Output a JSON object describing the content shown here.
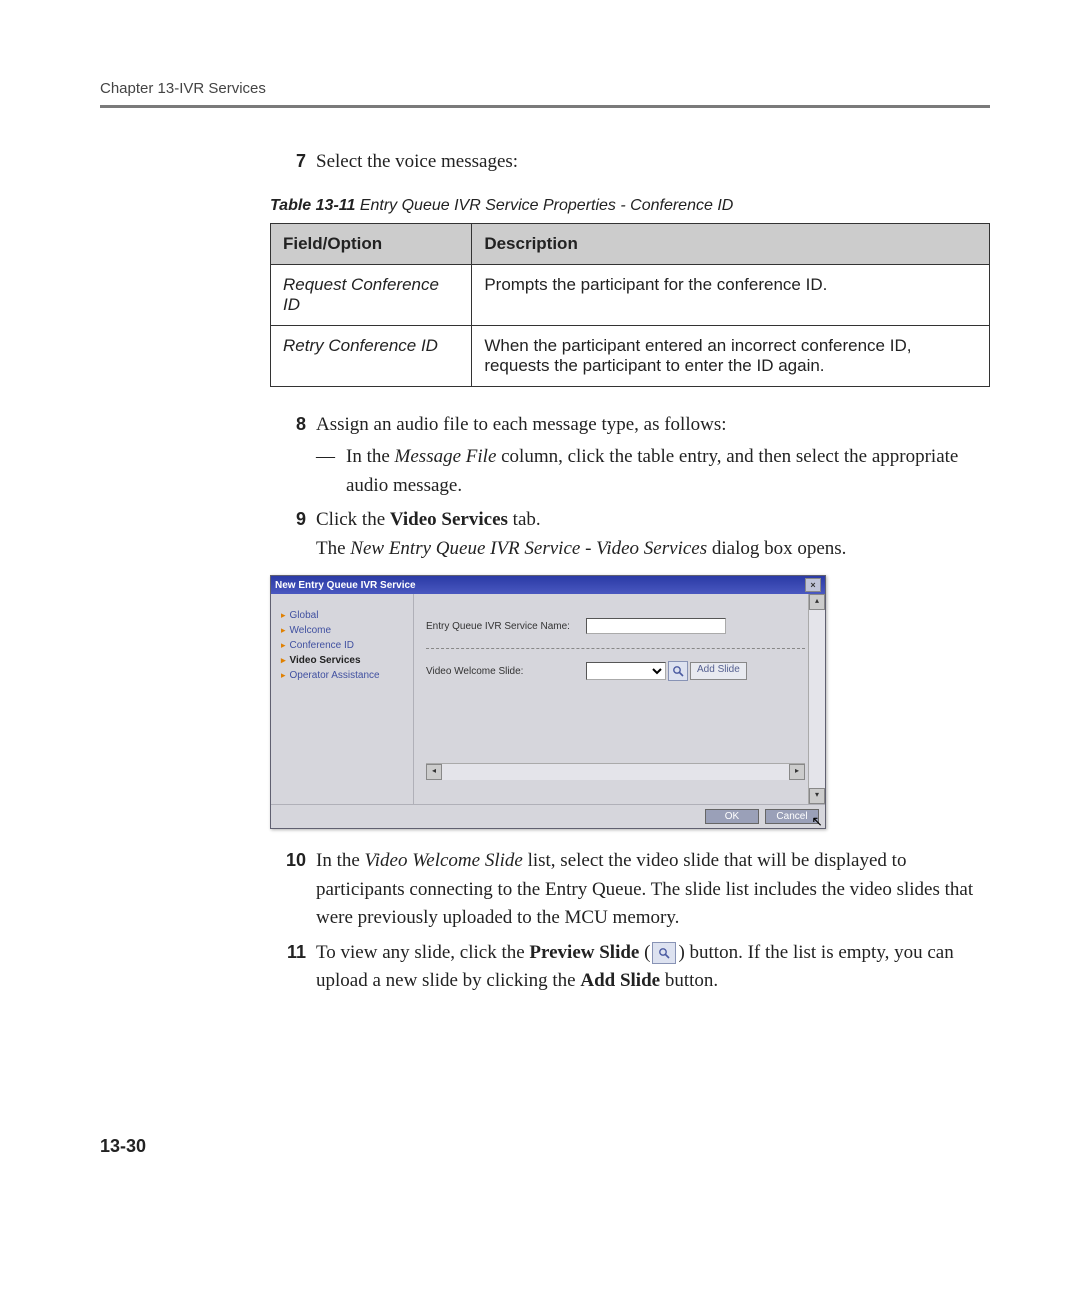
{
  "header": {
    "running": "Chapter 13-IVR Services"
  },
  "steps": {
    "s7": {
      "num": "7",
      "text": "Select the voice messages:"
    },
    "s8": {
      "num": "8",
      "text": "Assign an audio file to each message type, as follows:",
      "sub_pre": "In the ",
      "sub_em": "Message File",
      "sub_post": " column, click the table entry, and then select the appropriate audio message."
    },
    "s9": {
      "num": "9",
      "line1_pre": "Click the ",
      "line1_bold": "Video Services",
      "line1_post": " tab.",
      "line2_pre": "The ",
      "line2_em": "New Entry Queue IVR Service - Video Services",
      "line2_post": " dialog box opens."
    },
    "s10": {
      "num": "10",
      "pre": "In the ",
      "em": "Video Welcome Slide",
      "post": " list, select the video slide that will be displayed to participants connecting to the Entry Queue. The slide list includes the video slides that were previously uploaded to the MCU memory."
    },
    "s11": {
      "num": "11",
      "p1": "To view any slide, click the ",
      "b1": "Preview Slide",
      "p2": " (",
      "p3": ") button. If the list is empty, you can upload a new slide by clicking the ",
      "b2": "Add Slide",
      "p4": " button."
    }
  },
  "table": {
    "caption_label": "Table 13-11",
    "caption_title": " Entry Queue IVR Service Properties - Conference ID",
    "head_field": "Field/Option",
    "head_desc": "Description",
    "rows": [
      {
        "field": "Request Conference ID",
        "desc": "Prompts the participant for the conference ID."
      },
      {
        "field": "Retry Conference ID",
        "desc": "When the participant entered an incorrect conference ID, requests the participant to enter the ID again."
      }
    ]
  },
  "dialog": {
    "title": "New Entry Queue IVR Service",
    "nav": {
      "items": [
        "Global",
        "Welcome",
        "Conference ID",
        "Video Services",
        "Operator Assistance"
      ],
      "selected": "Video Services"
    },
    "svc_label": "Entry Queue IVR Service Name:",
    "svc_value": "",
    "vws_label": "Video Welcome Slide:",
    "vws_value": "",
    "add_slide": "Add Slide",
    "ok": "OK",
    "cancel": "Cancel"
  },
  "page_num": "13-30"
}
